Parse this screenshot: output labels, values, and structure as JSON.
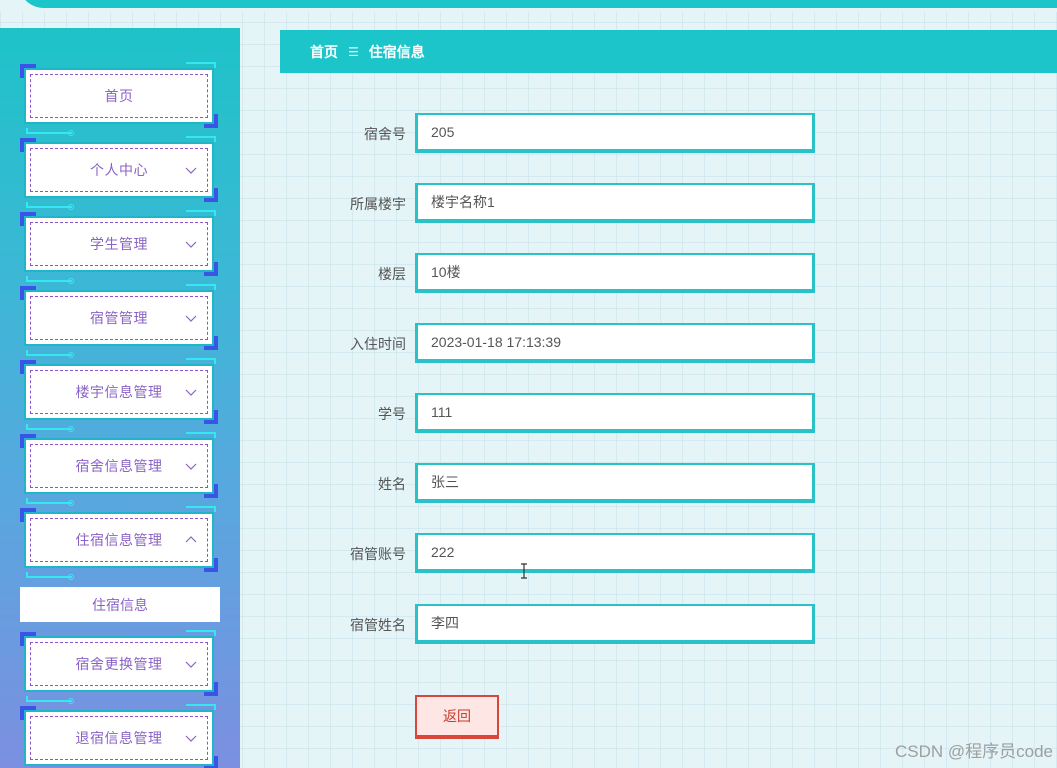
{
  "breadcrumb": {
    "home": "首页",
    "separator": "☰",
    "current": "住宿信息"
  },
  "sidebar": {
    "items": [
      {
        "label": "首页",
        "expandable": false
      },
      {
        "label": "个人中心",
        "expandable": true
      },
      {
        "label": "学生管理",
        "expandable": true
      },
      {
        "label": "宿管管理",
        "expandable": true
      },
      {
        "label": "楼宇信息管理",
        "expandable": true
      },
      {
        "label": "宿舍信息管理",
        "expandable": true
      },
      {
        "label": "住宿信息管理",
        "expandable": true,
        "expanded": true
      },
      {
        "label": "宿舍更换管理",
        "expandable": true
      },
      {
        "label": "退宿信息管理",
        "expandable": true
      }
    ],
    "sub_item": "住宿信息"
  },
  "form": {
    "fields": [
      {
        "label": "宿舍号",
        "value": "205"
      },
      {
        "label": "所属楼宇",
        "value": "楼宇名称1"
      },
      {
        "label": "楼层",
        "value": "10楼"
      },
      {
        "label": "入住时间",
        "value": "2023-01-18 17:13:39"
      },
      {
        "label": "学号",
        "value": "111"
      },
      {
        "label": "姓名",
        "value": "张三"
      },
      {
        "label": "宿管账号",
        "value": "222"
      },
      {
        "label": "宿管姓名",
        "value": "李四"
      }
    ],
    "back_label": "返回"
  },
  "watermark": "CSDN @程序员code",
  "colors": {
    "accent": "#1cc5c9",
    "menu_text": "#8a63c5",
    "danger": "#d9473a"
  },
  "icons": {
    "expand": "chevron-down-icon",
    "collapse": "chevron-up-icon"
  }
}
